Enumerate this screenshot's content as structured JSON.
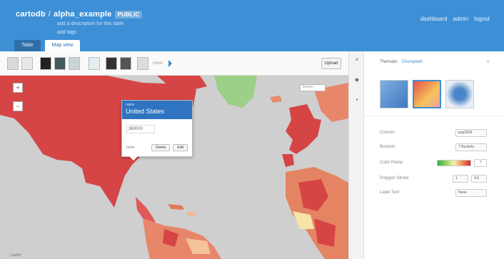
{
  "header": {
    "user": "cartodb",
    "separator": "/",
    "table_name": "alpha_example",
    "privacy_badge": "PUBLIC",
    "description": "add a description for this table",
    "edit_link": "add tags",
    "nav": [
      "dashboard",
      "admin",
      "logout"
    ],
    "tabs": [
      {
        "label": "Table",
        "active": false
      },
      {
        "label": "Map view",
        "active": true
      }
    ]
  },
  "basemap_bar": {
    "more_label": "more",
    "upload_label": "Upload"
  },
  "map": {
    "zoom_in": "+",
    "zoom_out": "−",
    "search_placeholder": "Search",
    "attribution": "Leaflet",
    "popup": {
      "small_label": "name",
      "title": "United States",
      "value": "360000",
      "footer_label": "more",
      "btn1": "Delete",
      "btn2": "Edit"
    }
  },
  "panel": {
    "tabs": [
      {
        "label": "Thematic",
        "active": false
      },
      {
        "label": "Choropleth",
        "active": true
      }
    ],
    "close": "×",
    "rows": [
      {
        "label": "Column",
        "value": "pop2005"
      },
      {
        "label": "Buckets",
        "value": "7 Buckets"
      },
      {
        "label": "Color Ramp",
        "count": "7"
      },
      {
        "label": "Polygon Stroke",
        "value_a": "1",
        "value_b": "0.6"
      },
      {
        "label": "Label Text",
        "value": "None"
      }
    ]
  },
  "colors": {
    "header_blue": "#3d8fd6",
    "map_land_high": "#d64545",
    "map_ocean": "#cfcfcf"
  }
}
